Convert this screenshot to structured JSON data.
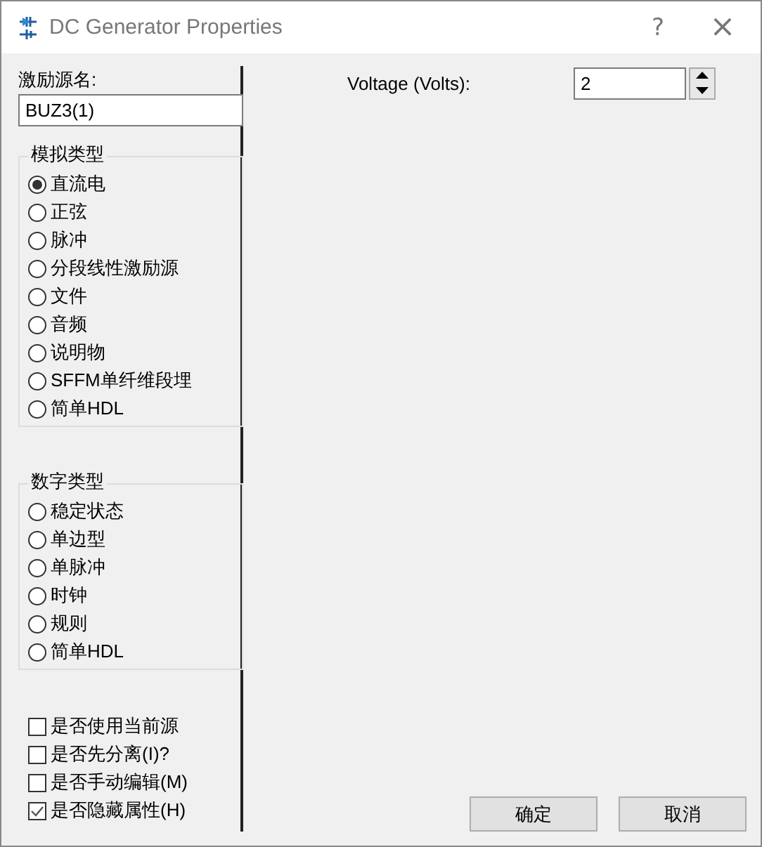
{
  "window": {
    "title": "DC Generator Properties",
    "buttons": [
      "?",
      "×"
    ]
  },
  "source_name": {
    "label": "激励源名:",
    "value": "BUZ3(1)"
  },
  "analog_types": {
    "title": "模拟类型",
    "options": [
      {
        "label": "直流电",
        "selected": true
      },
      {
        "label": "正弦",
        "selected": false
      },
      {
        "label": "脉冲",
        "selected": false
      },
      {
        "label": "分段线性激励源",
        "selected": false
      },
      {
        "label": "文件",
        "selected": false
      },
      {
        "label": "音频",
        "selected": false
      },
      {
        "label": "说明物",
        "selected": false
      },
      {
        "label": "SFFM单纤维段埋",
        "selected": false
      },
      {
        "label": "简单HDL",
        "selected": false
      }
    ]
  },
  "digital_types": {
    "title": "数字类型",
    "options": [
      {
        "label": "稳定状态",
        "selected": false
      },
      {
        "label": "单边型",
        "selected": false
      },
      {
        "label": "单脉冲",
        "selected": false
      },
      {
        "label": "时钟",
        "selected": false
      },
      {
        "label": "规则",
        "selected": false
      },
      {
        "label": "简单HDL",
        "selected": false
      }
    ]
  },
  "options": [
    {
      "label": "是否使用当前源",
      "checked": false
    },
    {
      "label": "是否先分离(I)?",
      "checked": false
    },
    {
      "label": "是否手动编辑(M)",
      "checked": false
    },
    {
      "label": "是否隐藏属性(H)",
      "checked": true
    }
  ],
  "voltage": {
    "label": "Voltage (Volts):",
    "value": "2"
  },
  "buttons": [
    "确定",
    "取消"
  ]
}
